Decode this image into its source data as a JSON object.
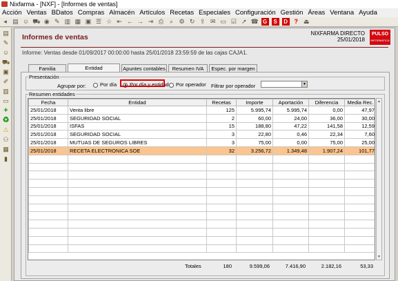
{
  "window": {
    "title": "Nixfarma - [NXF] - [Informes de ventas]"
  },
  "menu": [
    "Acción",
    "Ventas",
    "BDatos",
    "Compras",
    "Almacén",
    "Artículos",
    "Recetas",
    "Especiales",
    "Configuración",
    "Gestión",
    "Áreas",
    "Ventana",
    "Ayuda"
  ],
  "header": {
    "title": "Informes de ventas",
    "company": "NIXFARMA DIRECTO",
    "date": "25/01/2018",
    "logo_text": "PULSO",
    "logo_sub": "INFORMATICA"
  },
  "info_text": "Informe:  Ventas desde 01/09/2017 00:00:00 hasta 25/01/2018 23:59:59 de las cajas CAJA1.",
  "tabs": [
    "Familia",
    "Entidad",
    "Apuntes contables",
    "Resumen IVA",
    "Espec. por margen"
  ],
  "active_tab": "Entidad",
  "presentacion": {
    "label": "Presentación",
    "group_label": "Agrupar por:",
    "options": [
      "Por día",
      "Por día y entidad",
      "Por operador"
    ],
    "selected": "Por día y entidad",
    "filter_label": "Filtrar por operador",
    "filter_value": ""
  },
  "resumen": {
    "label": "Resumen entidades",
    "columns": [
      "Fecha",
      "Entidad",
      "Recetas",
      "Importe",
      "Aportación",
      "Diferencia",
      "Media Rec."
    ],
    "rows": [
      [
        "25/01/2018",
        "Venta libre",
        "125",
        "5.995,74",
        "5.995,74",
        "0,00",
        "47,97"
      ],
      [
        "25/01/2018",
        "SEGURIDAD SOCIAL",
        "2",
        "60,00",
        "24,00",
        "36,00",
        "30,00"
      ],
      [
        "25/01/2018",
        "ISFAS",
        "15",
        "188,80",
        "47,22",
        "141,58",
        "12,59"
      ],
      [
        "25/01/2018",
        "SEGURIDAD SOCIAL",
        "3",
        "22,80",
        "0,46",
        "22,34",
        "7,60"
      ],
      [
        "25/01/2018",
        "MUTUAS DE SEGUROS LIBRES",
        "3",
        "75,00",
        "0,00",
        "75,00",
        "25,00"
      ],
      [
        "25/01/2018",
        "RECETA ELECTRONICA SOE",
        "32",
        "3.256,72",
        "1.349,48",
        "1.907,24",
        "101,77"
      ]
    ],
    "selected_row": 5,
    "totals": {
      "label": "Totales",
      "recetas": "180",
      "importe": "9.599,06",
      "aportacion": "7.416,90",
      "diferencia": "2.182,16",
      "media": "53,33"
    }
  }
}
